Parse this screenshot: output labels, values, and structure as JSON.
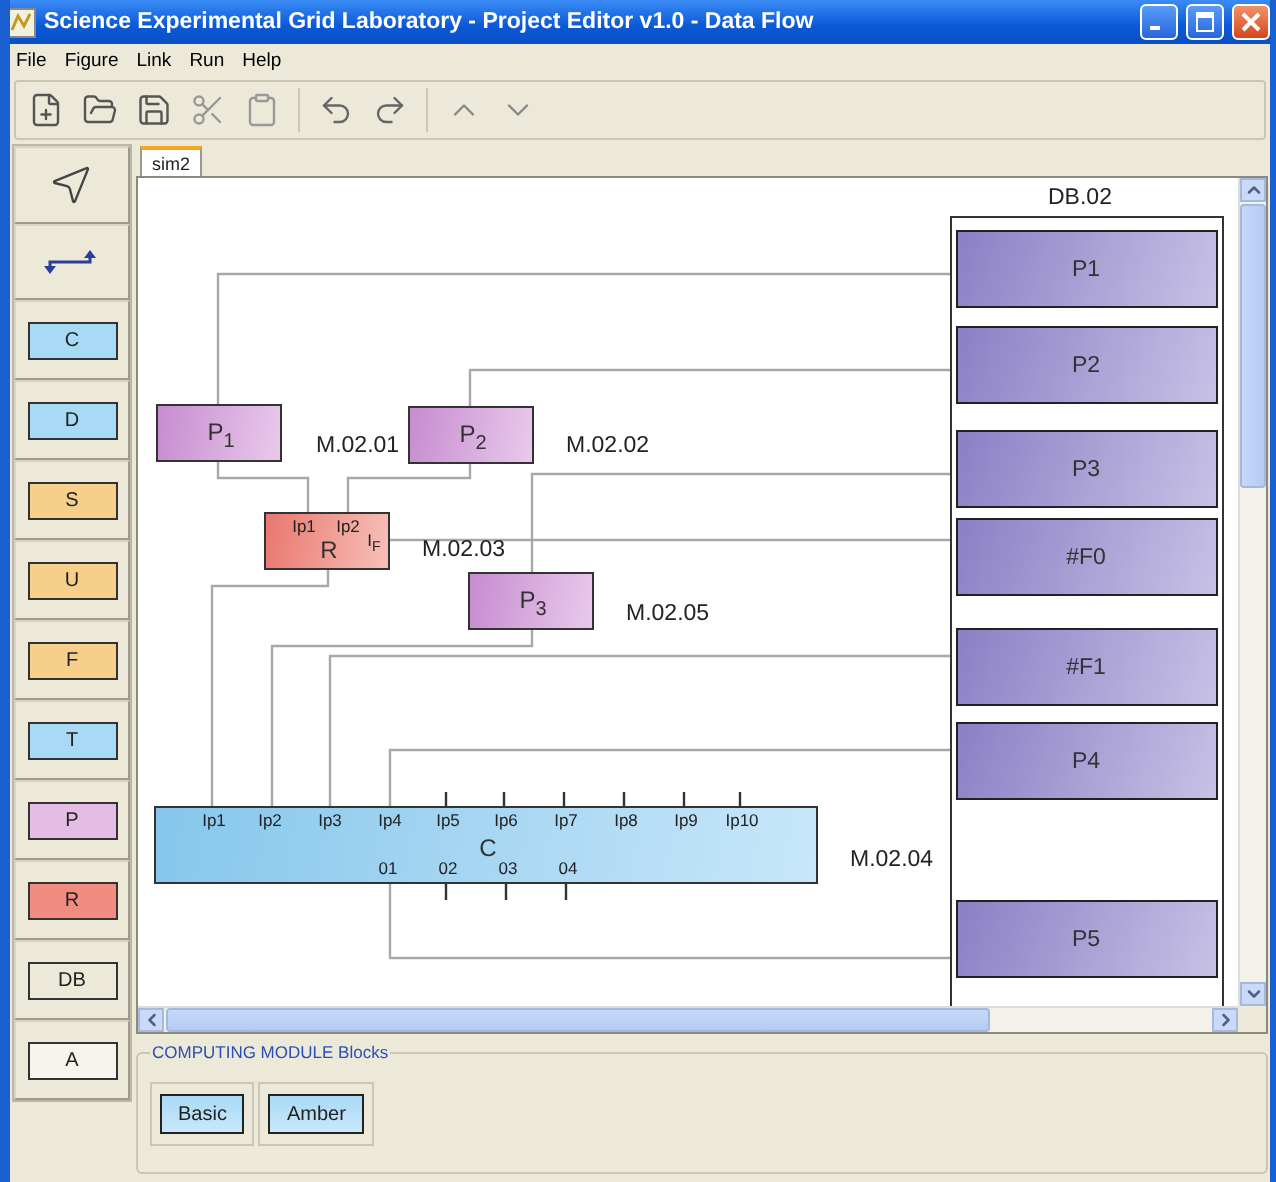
{
  "window": {
    "title": "Science Experimental Grid Laboratory - Project Editor v1.0 - Data Flow"
  },
  "menu": [
    "File",
    "Figure",
    "Link",
    "Run",
    "Help"
  ],
  "palette": [
    {
      "kind": "pointer"
    },
    {
      "kind": "link"
    },
    {
      "kind": "block",
      "label": "C",
      "color": "#a8daf5"
    },
    {
      "kind": "block",
      "label": "D",
      "color": "#a8daf5"
    },
    {
      "kind": "block",
      "label": "S",
      "color": "#f6cf8a"
    },
    {
      "kind": "block",
      "label": "U",
      "color": "#f6cf8a"
    },
    {
      "kind": "block",
      "label": "F",
      "color": "#f6cf8a"
    },
    {
      "kind": "block",
      "label": "T",
      "color": "#a8daf5"
    },
    {
      "kind": "block",
      "label": "P",
      "color": "#e3bde6"
    },
    {
      "kind": "block",
      "label": "R",
      "color": "#f08c80"
    },
    {
      "kind": "block",
      "label": "DB",
      "color": "#ece9d8"
    },
    {
      "kind": "block",
      "label": "A",
      "color": "#f6f4ec"
    }
  ],
  "tabs": [
    {
      "label": "sim2",
      "selected": true
    }
  ],
  "diagram": {
    "modules": [
      {
        "kind": "process",
        "label": "P$_{1}$",
        "tag": "M.02.01"
      },
      {
        "kind": "process",
        "label": "P$_{2}$",
        "tag": "M.02.02"
      },
      {
        "kind": "router",
        "label": "R",
        "tag": "M.02.03",
        "inputs": [
          "Ip1",
          "Ip2"
        ],
        "outputs": [
          "I$_{F}$"
        ]
      },
      {
        "kind": "process",
        "label": "P$_{3}$",
        "tag": "M.02.05"
      },
      {
        "kind": "compute",
        "label": "C",
        "tag": "M.02.04",
        "inputs": [
          "Ip1",
          "Ip2",
          "Ip3",
          "Ip4",
          "Ip5",
          "Ip6",
          "Ip7",
          "Ip8",
          "Ip9",
          "Ip10"
        ],
        "outputs": [
          "01",
          "02",
          "03",
          "04"
        ]
      }
    ],
    "database": {
      "title": "DB.02",
      "items": [
        "P1",
        "P2",
        "P3",
        "#F0",
        "#F1",
        "P4",
        "P5"
      ]
    }
  },
  "blocks_panel": {
    "title": "COMPUTING MODULE Blocks",
    "buttons": [
      "Basic",
      "Amber"
    ]
  }
}
